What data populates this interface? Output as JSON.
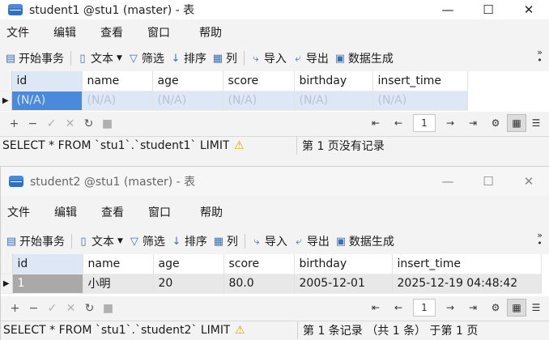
{
  "win1": {
    "title": "student1 @stu1 (master) - 表",
    "menu": [
      "文件",
      "编辑",
      "查看",
      "窗口",
      "帮助"
    ],
    "toolbar": {
      "begin_tx": "开始事务",
      "text": "文本",
      "filter": "筛选",
      "sort": "排序",
      "column": "列",
      "import": "导入",
      "export": "导出",
      "datagen": "数据生成"
    },
    "columns": [
      "id",
      "name",
      "age",
      "score",
      "birthday",
      "insert_time"
    ],
    "row": [
      "(N/A)",
      "(N/A)",
      "(N/A)",
      "(N/A)",
      "(N/A)",
      "(N/A)"
    ],
    "page": "1",
    "sql": "SELECT * FROM `stu1`.`student1` LIMIT",
    "warn_icon": "⚠",
    "status": "第 1 页没有记录"
  },
  "win2": {
    "title": "student2 @stu1 (master) - 表",
    "menu": [
      "文件",
      "编辑",
      "查看",
      "窗口",
      "帮助"
    ],
    "toolbar": {
      "begin_tx": "开始事务",
      "text": "文本",
      "filter": "筛选",
      "sort": "排序",
      "column": "列",
      "import": "导入",
      "export": "导出",
      "datagen": "数据生成"
    },
    "columns": [
      "id",
      "name",
      "age",
      "score",
      "birthday",
      "insert_time"
    ],
    "row": [
      "1",
      "小明",
      "20",
      "80.0",
      "2005-12-01",
      "2025-12-19 04:48:42"
    ],
    "page": "1",
    "sql": "SELECT * FROM `stu1`.`student2` LIMIT",
    "warn_icon": "⚠",
    "status": "第 1 条记录 （共 1 条） 于第 1 页"
  },
  "colors": {
    "selected_row": "#dde7f6",
    "current_cell": "#4a89dc",
    "warning": "#e8a400"
  }
}
